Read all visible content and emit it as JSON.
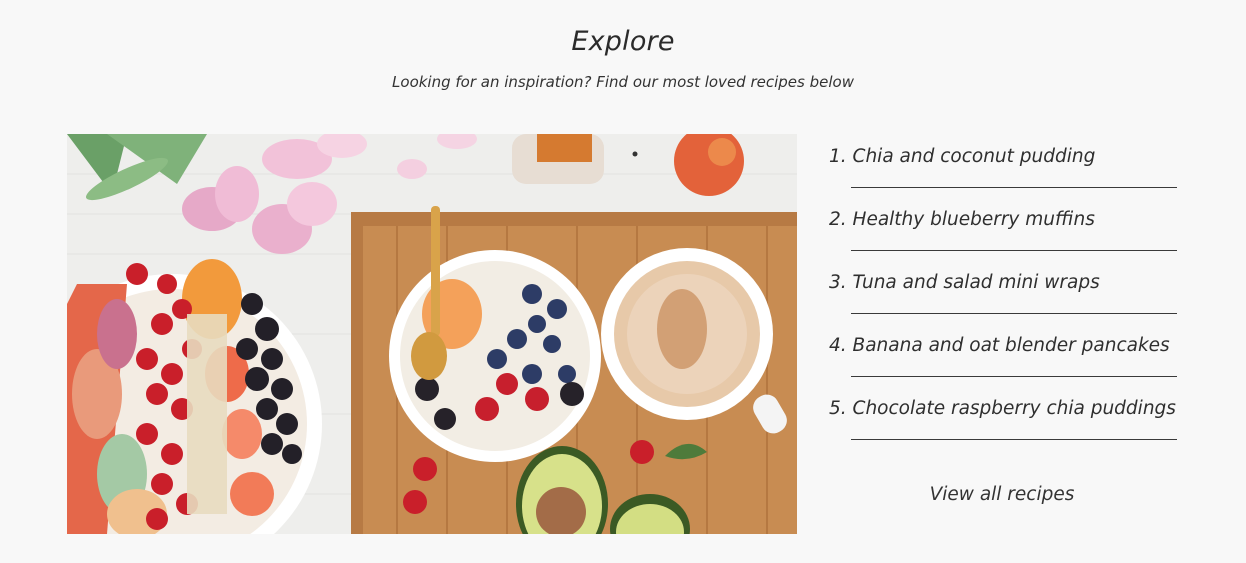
{
  "header": {
    "title": "Explore",
    "subtitle": "Looking for an inspiration? Find our most loved recipes below"
  },
  "hero_image": {
    "description_icon": "food-photo"
  },
  "recipes": {
    "items": [
      {
        "label": "1. Chia and coconut pudding"
      },
      {
        "label": "2. Healthy blueberry muffins"
      },
      {
        "label": "3. Tuna and salad mini wraps"
      },
      {
        "label": "4. Banana and oat blender pancakes"
      },
      {
        "label": "5. Chocolate raspberry chia puddings"
      }
    ],
    "view_all_label": "View all recipes"
  },
  "colors": {
    "background": "#f8f8f8",
    "text": "#333333",
    "rule": "#3a3a3a"
  }
}
